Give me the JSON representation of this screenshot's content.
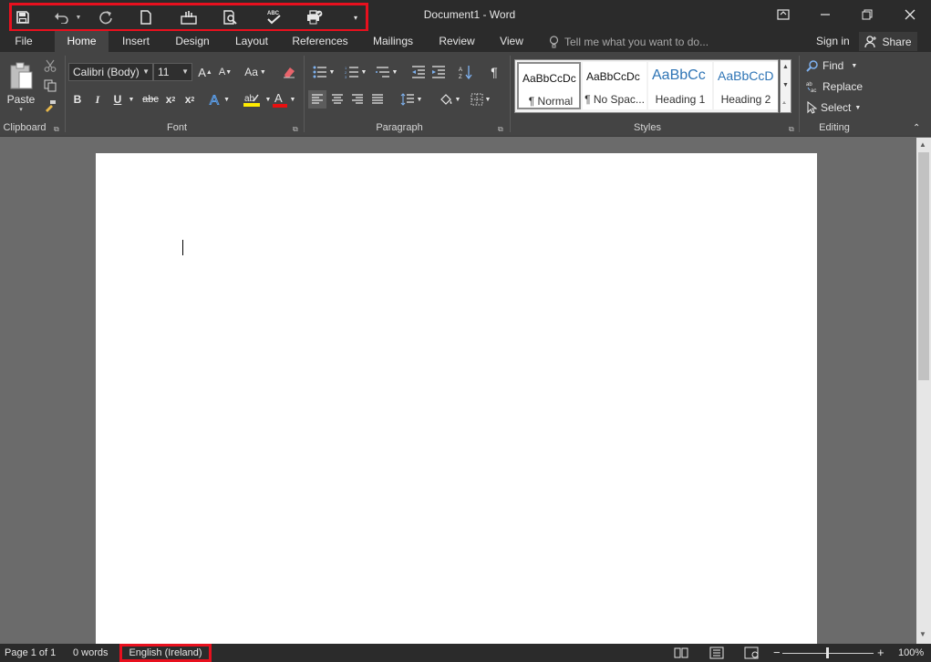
{
  "window": {
    "title": "Document1 - Word",
    "controls": [
      "ribbon-display-options",
      "minimize",
      "restore",
      "close"
    ]
  },
  "quick_access_toolbar": {
    "highlighted": true,
    "items": [
      {
        "name": "save",
        "icon": "save-icon"
      },
      {
        "name": "undo",
        "icon": "undo-icon"
      },
      {
        "name": "redo",
        "icon": "redo-icon"
      },
      {
        "name": "new",
        "icon": "new-document-icon"
      },
      {
        "name": "touch-mode",
        "icon": "touch-mode-icon"
      },
      {
        "name": "print-preview",
        "icon": "print-preview-icon"
      },
      {
        "name": "spelling",
        "icon": "spelling-check-icon"
      },
      {
        "name": "quick-print",
        "icon": "quick-print-icon"
      },
      {
        "name": "customize",
        "icon": "customize-dropdown-icon"
      }
    ]
  },
  "tabs": [
    {
      "label": "File",
      "active": false
    },
    {
      "label": "Home",
      "active": true
    },
    {
      "label": "Insert",
      "active": false
    },
    {
      "label": "Design",
      "active": false
    },
    {
      "label": "Layout",
      "active": false
    },
    {
      "label": "References",
      "active": false
    },
    {
      "label": "Mailings",
      "active": false
    },
    {
      "label": "Review",
      "active": false
    },
    {
      "label": "View",
      "active": false
    }
  ],
  "tell_me": {
    "placeholder": "Tell me what you want to do..."
  },
  "account": {
    "signin": "Sign in",
    "share": "Share"
  },
  "ribbon": {
    "clipboard": {
      "label": "Clipboard",
      "paste": "Paste"
    },
    "font": {
      "label": "Font",
      "font_name": "Calibri (Body)",
      "font_size": "11",
      "change_case": "Aa",
      "bold": "B",
      "italic": "I",
      "underline": "U",
      "strikethrough": "abc",
      "subscript": "x",
      "superscript": "x",
      "grow": "A",
      "shrink": "A",
      "font_color_accent": "#e81010",
      "highlight_accent": "#ffeb00"
    },
    "paragraph": {
      "label": "Paragraph"
    },
    "styles": {
      "label": "Styles",
      "items": [
        {
          "sample": "AaBbCcDc",
          "name": "¶ Normal",
          "color": "#111111"
        },
        {
          "sample": "AaBbCcDc",
          "name": "¶ No Spac...",
          "color": "#111111"
        },
        {
          "sample": "AaBbCc",
          "name": "Heading 1",
          "color": "#2e74b5"
        },
        {
          "sample": "AaBbCcD",
          "name": "Heading 2",
          "color": "#2e74b5"
        }
      ]
    },
    "editing": {
      "label": "Editing",
      "find": "Find",
      "replace": "Replace",
      "select": "Select"
    }
  },
  "statusbar": {
    "page": "Page 1 of 1",
    "words": "0 words",
    "language": "English (Ireland)",
    "language_highlighted": true,
    "zoom": "100%"
  },
  "colors": {
    "dark_chrome": "#2b2b2b",
    "ribbon": "#444444",
    "highlight_red": "#e8101e",
    "doc_background": "#6b6b6b"
  }
}
